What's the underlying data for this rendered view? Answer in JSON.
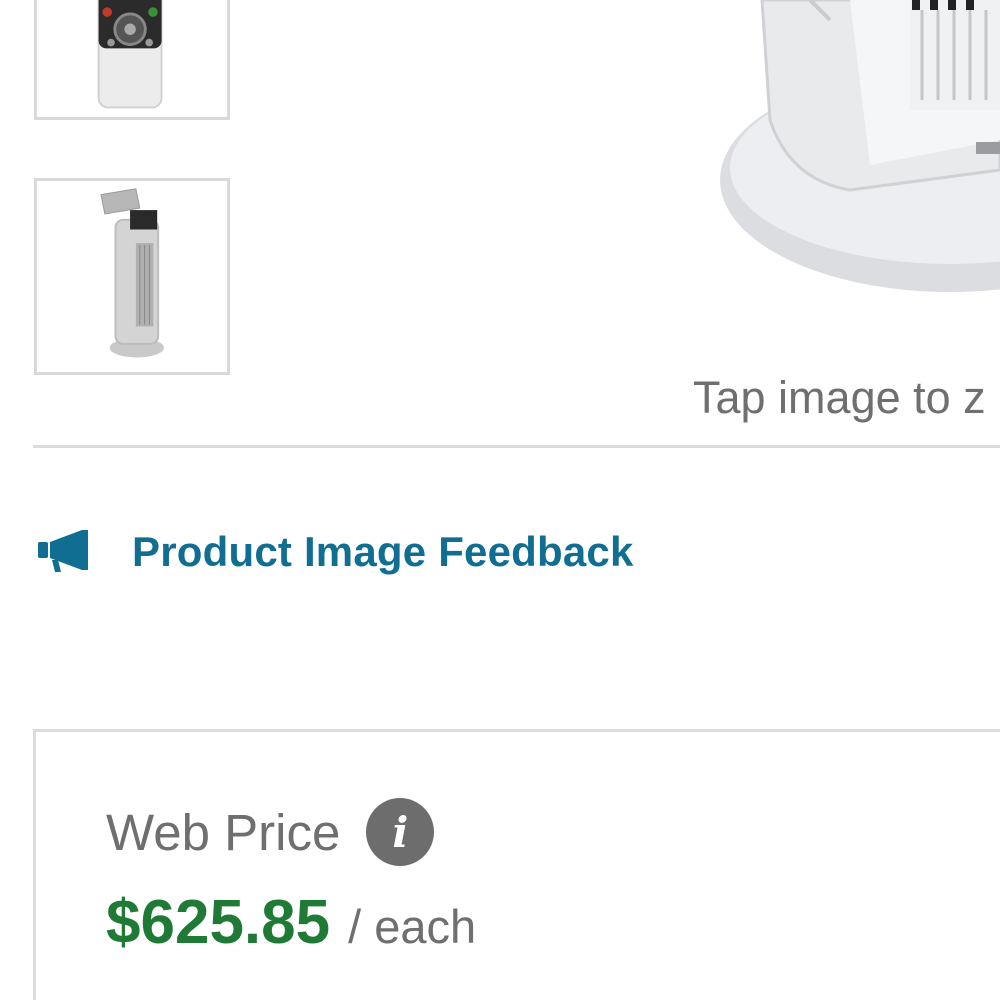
{
  "gallery": {
    "thumbnails": [
      {
        "alt_icon": "remote-control-image"
      },
      {
        "alt_icon": "tower-heater-image"
      }
    ],
    "main_image_icon": "tower-heater-main-image",
    "zoom_hint": "Tap image to z"
  },
  "feedback": {
    "icon": "megaphone-icon",
    "label": "Product Image Feedback"
  },
  "pricing": {
    "label": "Web Price",
    "info_icon_glyph": "i",
    "price": "$625.85",
    "unit": "/ each"
  },
  "colors": {
    "link": "#0f6e91",
    "price": "#1f7a35",
    "muted_text": "#6f6f6f",
    "border": "#dcdcdc"
  }
}
